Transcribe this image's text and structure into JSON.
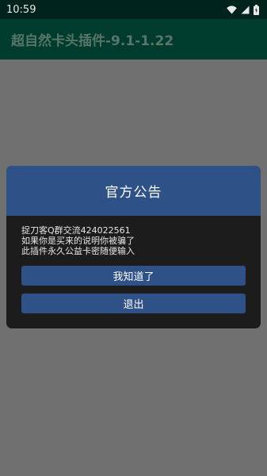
{
  "status_bar": {
    "time": "10:59",
    "icons": [
      "wifi-icon",
      "signal-icon",
      "battery-icon"
    ]
  },
  "app_bar": {
    "title": "超自然卡头插件-9.1-1.22"
  },
  "dialog": {
    "title": "官方公告",
    "lines": [
      "捉刀客Q群交流424022561",
      "如果你是买来的说明你被骗了",
      "此插件永久公益卡密随便输入"
    ],
    "buttons": {
      "ok_label": "我知道了",
      "exit_label": "退出"
    }
  },
  "colors": {
    "status_bar": "#00241c",
    "app_bar": "#003c2e",
    "scrim": "#707070",
    "dialog_bg": "#1c1c1c",
    "accent": "#2e5188"
  }
}
